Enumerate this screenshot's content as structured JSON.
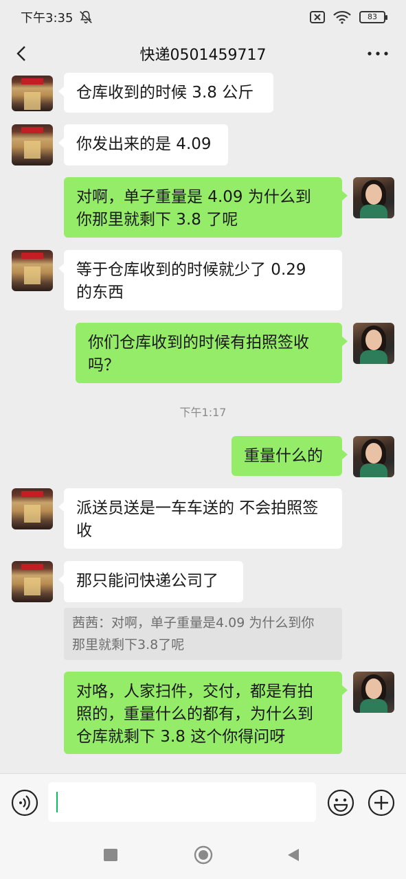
{
  "status_bar": {
    "time": "下午3:35",
    "battery": "83"
  },
  "header": {
    "title": "快递0501459717"
  },
  "messages": [
    {
      "side": "left",
      "text": "仓库收到的时候 3.8 公斤"
    },
    {
      "side": "left",
      "text": "你发出来的是 4.09"
    },
    {
      "side": "right",
      "lines": [
        "对啊，单子重量是 4.09  为什么到",
        "你那里就剩下 3.8 了呢"
      ]
    },
    {
      "side": "left",
      "lines": [
        "等于仓库收到的时候就少了 0.29",
        "的东西"
      ]
    },
    {
      "side": "right",
      "lines": [
        "你们仓库收到的时候有拍照签收",
        "吗？"
      ]
    },
    {
      "type": "time",
      "text": "下午1:17"
    },
    {
      "side": "right",
      "text": "重量什么的"
    },
    {
      "side": "left",
      "lines": [
        "派送员送是一车车送的 不会拍照签",
        "收"
      ]
    },
    {
      "side": "left",
      "text": "那只能问快递公司了",
      "quote_lines": [
        "茜茜：对啊，单子重量是4.09  为什么到你",
        "那里就剩下3.8了呢"
      ]
    },
    {
      "side": "right",
      "lines": [
        "对咯，人家扫件，交付，都是有拍",
        "照的，重量什么的都有，为什么到",
        "仓库就剩下 3.8  这个你得问呀"
      ]
    }
  ],
  "input": {
    "value": ""
  },
  "icons": {
    "back": "back-arrow-icon",
    "more": "more-dots-icon",
    "voice": "voice-icon",
    "emoji": "emoji-icon",
    "plus": "plus-icon",
    "mute": "mute-bell-icon",
    "wifi": "wifi-icon",
    "sim": "no-sim-icon",
    "battery": "battery-icon"
  },
  "colors": {
    "sent_bubble": "#95ec69",
    "received_bubble": "#ffffff",
    "background": "#ededed",
    "caret": "#07c160"
  }
}
